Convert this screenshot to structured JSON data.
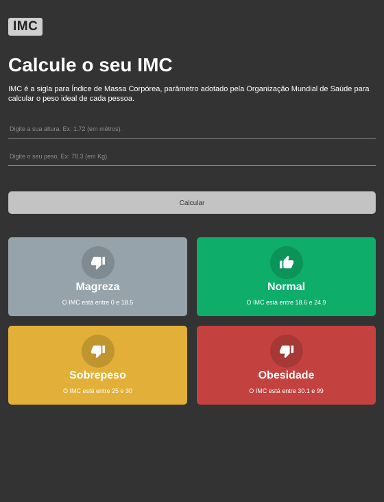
{
  "header": {
    "logo_text": "IMC",
    "title": "Calcule o seu IMC",
    "description": "IMC é a sigla para Índice de Massa Corpórea, parâmetro adotado pela Organização Mundial de Saúde para calcular o peso ideal de cada pessoa."
  },
  "form": {
    "height_placeholder": "Digite a sua altura. Ex: 1.72 (em métros).",
    "weight_placeholder": "Digite o seu peso. Ex: 78.3 (em Kg).",
    "calculate_label": "Calcular"
  },
  "categories": [
    {
      "title": "Magreza",
      "range": "O IMC está entre 0 e 18.5",
      "color": "#96a3ab",
      "icon": "thumbs-down-icon"
    },
    {
      "title": "Normal",
      "range": "O IMC está entre 18.6 e 24.9",
      "color": "#0ead69",
      "icon": "thumbs-up-icon"
    },
    {
      "title": "Sobrepeso",
      "range": "O IMC está entre 25 e 30",
      "color": "#e2b039",
      "icon": "thumbs-down-icon"
    },
    {
      "title": "Obesidade",
      "range": "O IMC está entre 30.1 e 99",
      "color": "#c3423f",
      "icon": "thumbs-down-icon"
    }
  ]
}
